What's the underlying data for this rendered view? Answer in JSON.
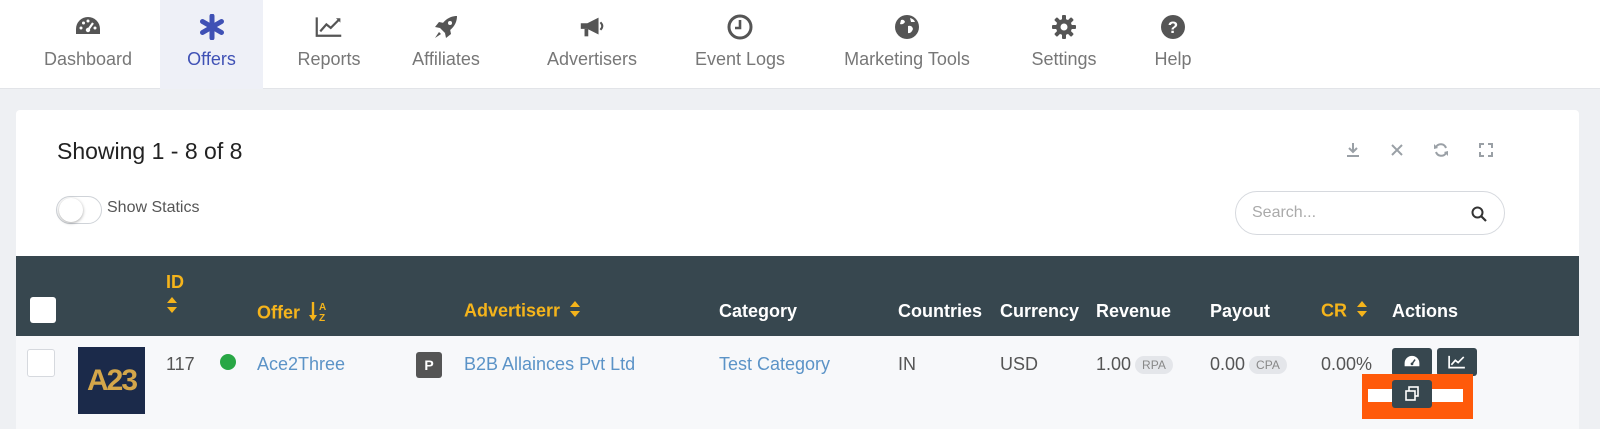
{
  "nav": {
    "items": [
      {
        "label": "Dashboard",
        "icon": "dashboard-icon"
      },
      {
        "label": "Offers",
        "icon": "asterisk-icon",
        "active": true
      },
      {
        "label": "Reports",
        "icon": "line-chart-icon"
      },
      {
        "label": "Affiliates",
        "icon": "rocket-icon"
      },
      {
        "label": "Advertisers",
        "icon": "megaphone-icon"
      },
      {
        "label": "Event Logs",
        "icon": "clock-icon"
      },
      {
        "label": "Marketing Tools",
        "icon": "globe-icon"
      },
      {
        "label": "Settings",
        "icon": "gear-icon"
      },
      {
        "label": "Help",
        "icon": "question-icon"
      }
    ]
  },
  "toolbar": {
    "showing_text": "Showing 1 - 8 of 8",
    "icons": [
      "download-icon",
      "close-icon",
      "refresh-icon",
      "fullscreen-icon"
    ],
    "show_statics_label": "Show Statics",
    "show_statics_on": false,
    "search_placeholder": "Search..."
  },
  "table": {
    "columns": {
      "id": "ID",
      "offer": "Offer",
      "advertiser": "Advertiserr",
      "category": "Category",
      "countries": "Countries",
      "currency": "Currency",
      "revenue": "Revenue",
      "payout": "Payout",
      "cr": "CR",
      "actions": "Actions"
    },
    "rows": [
      {
        "logo_text": "A23",
        "id": "117",
        "status_color": "#28a745",
        "offer": "Ace2Three",
        "badge": "P",
        "advertiser": "B2B Allainces Pvt Ltd",
        "category": "Test Category",
        "countries": "IN",
        "currency": "USD",
        "revenue": "1.00",
        "revenue_type": "RPA",
        "payout": "0.00",
        "payout_type": "CPA",
        "cr": "0.00%"
      }
    ]
  },
  "colors": {
    "accent": "#3f51b5",
    "sort_header": "#f5b41b",
    "header_bg": "#37474f",
    "link": "#5b93c7",
    "highlight": "#ff5a0a"
  }
}
